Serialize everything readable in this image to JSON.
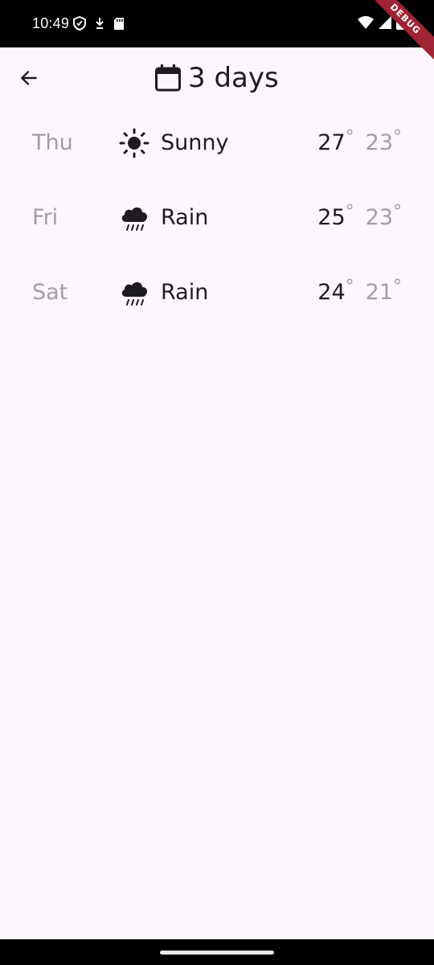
{
  "status_bar": {
    "time": "10:49",
    "debug_label": "DEBUG",
    "icons": [
      "shield-icon",
      "download-icon",
      "sd-card-icon",
      "wifi-icon",
      "signal-icon",
      "battery-icon"
    ]
  },
  "app_bar": {
    "back_icon": "arrow-back-icon",
    "title_icon": "calendar-icon",
    "title": "3 days"
  },
  "forecast": [
    {
      "day": "Thu",
      "icon": "sunny-icon",
      "condition": "Sunny",
      "high": "27",
      "low": "23"
    },
    {
      "day": "Fri",
      "icon": "rain-icon",
      "condition": "Rain",
      "high": "25",
      "low": "23"
    },
    {
      "day": "Sat",
      "icon": "rain-icon",
      "condition": "Rain",
      "high": "24",
      "low": "21"
    }
  ],
  "degree_symbol": "°",
  "colors": {
    "background": "#fdf7fd",
    "primary_text": "#1d1b20",
    "secondary_text": "#a19ea2",
    "debug_ribbon": "#a02433"
  }
}
